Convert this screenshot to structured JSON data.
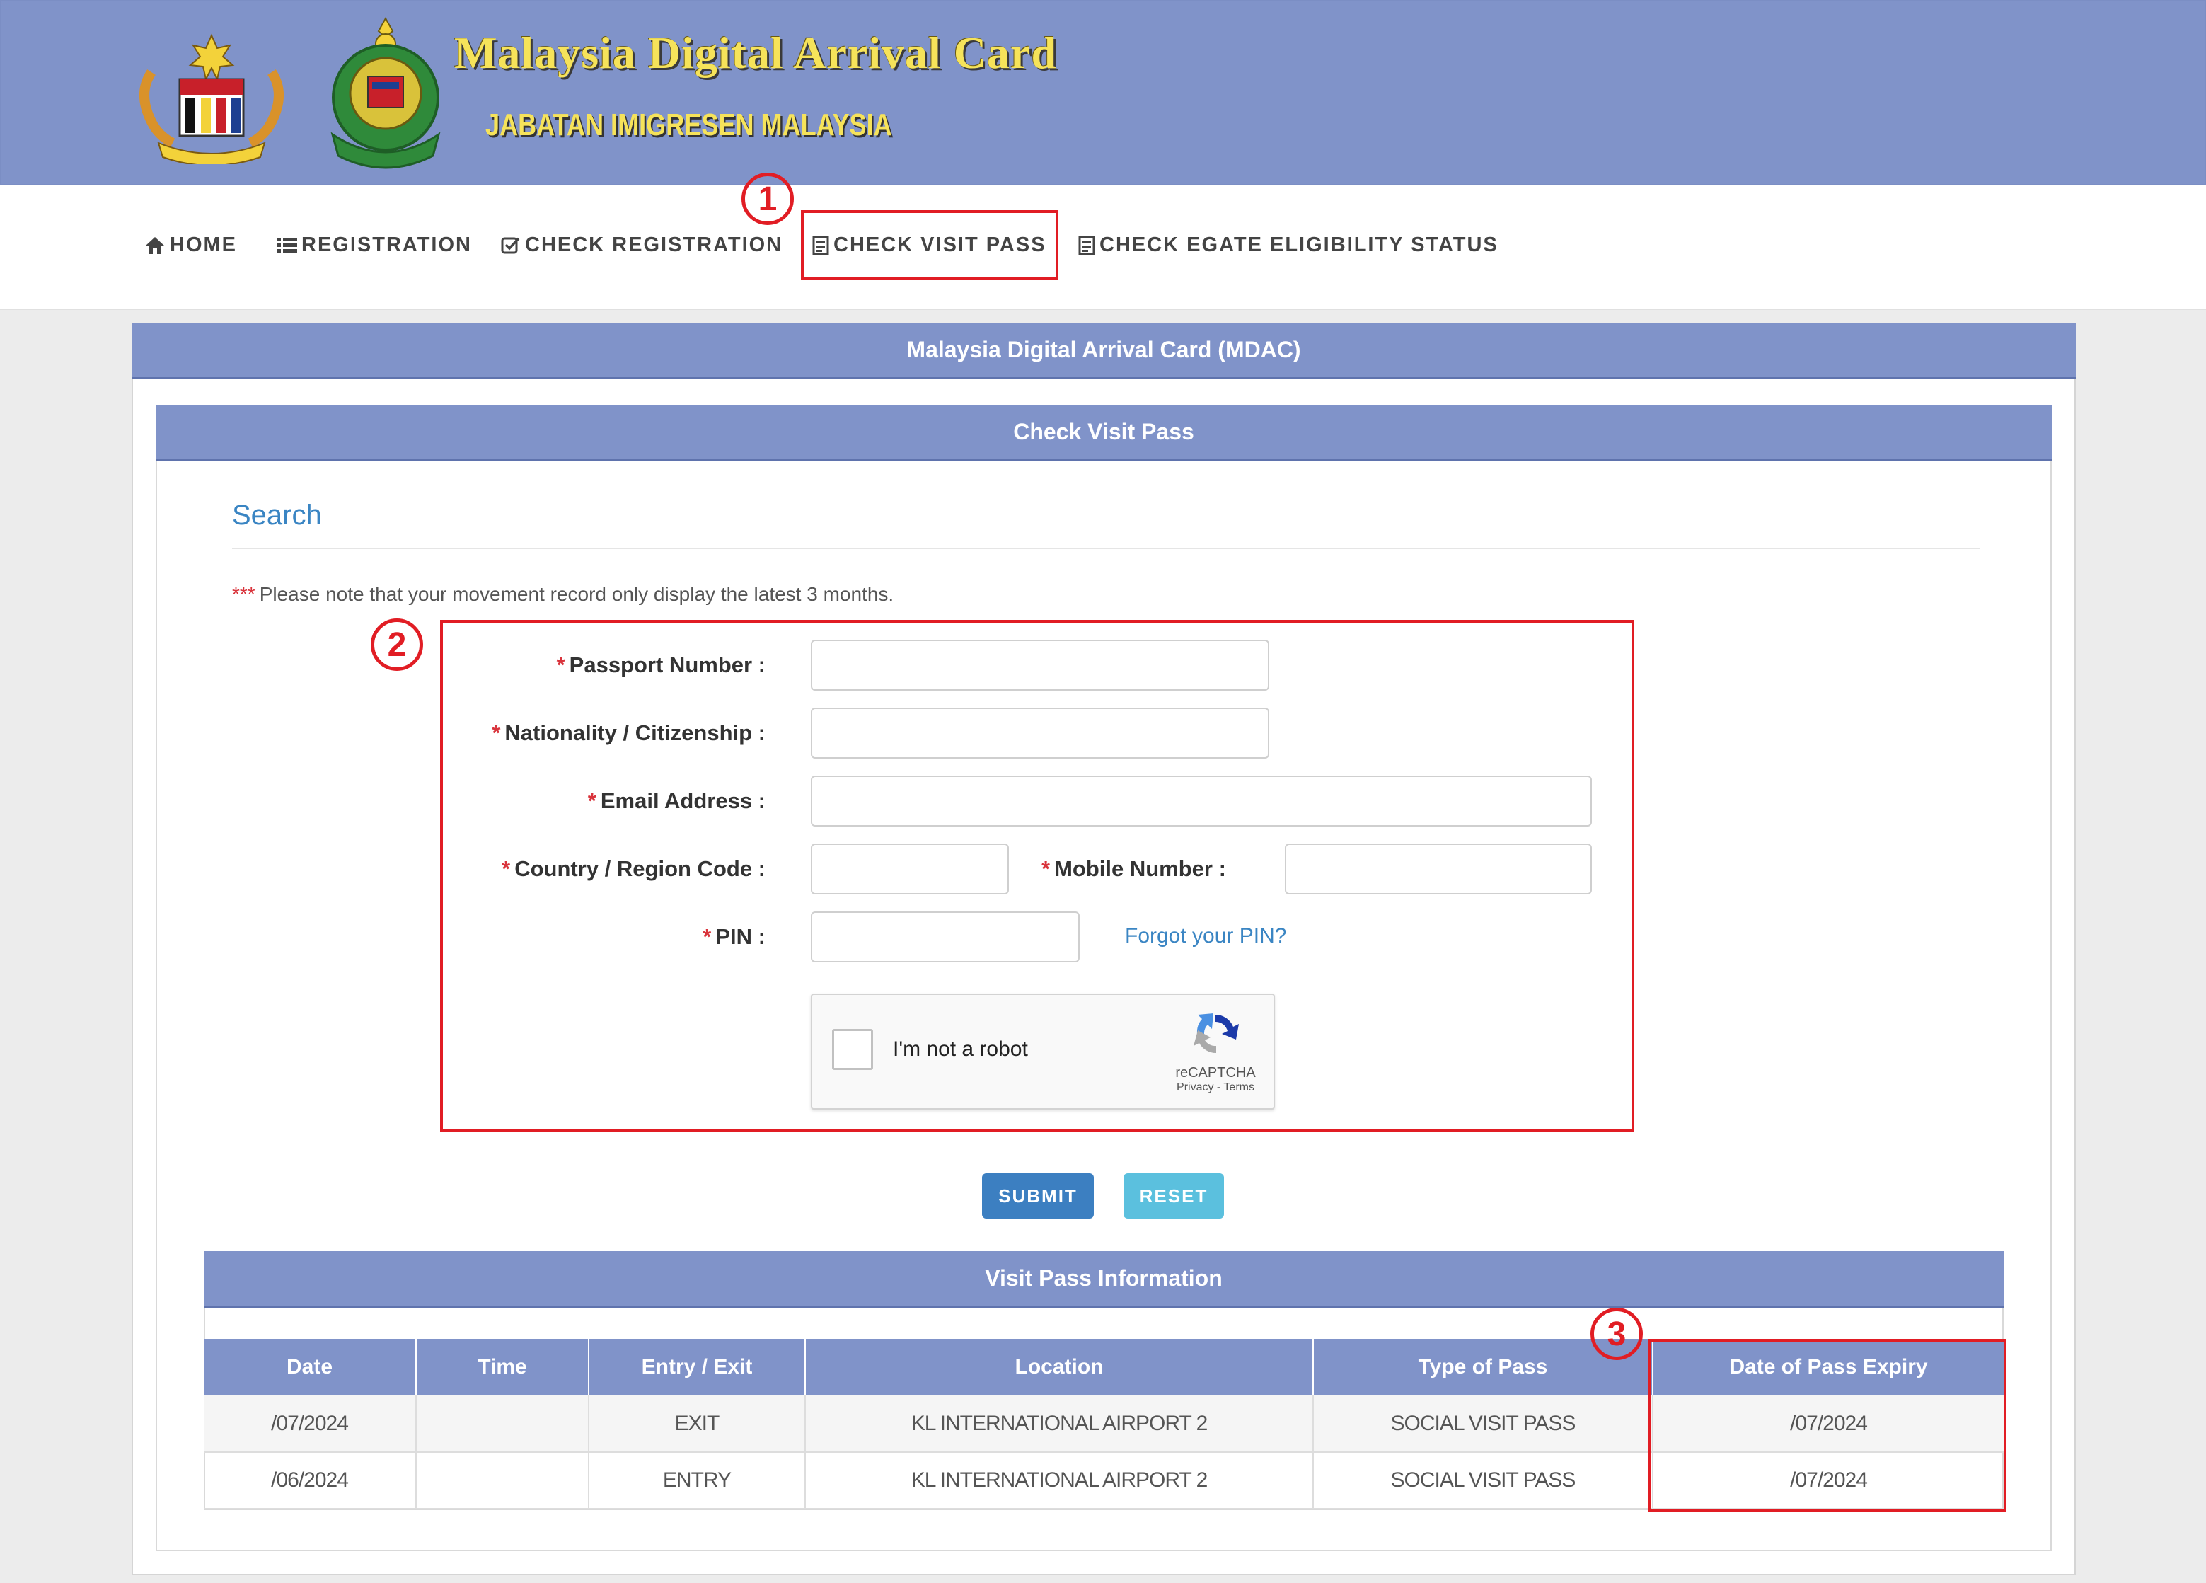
{
  "header": {
    "title": "Malaysia Digital Arrival Card",
    "subtitle": "JABATAN IMIGRESEN MALAYSIA"
  },
  "nav": {
    "items": [
      {
        "label": "HOME",
        "icon": "home-icon"
      },
      {
        "label": "REGISTRATION",
        "icon": "list-icon"
      },
      {
        "label": "CHECK REGISTRATION",
        "icon": "check-icon"
      },
      {
        "label": "CHECK VISIT PASS",
        "icon": "document-icon"
      },
      {
        "label": "CHECK EGATE ELIGIBILITY STATUS",
        "icon": "document-icon"
      }
    ]
  },
  "annotations": {
    "m1": "1",
    "m2": "2",
    "m3": "3"
  },
  "panel": {
    "title": "Malaysia Digital Arrival Card (MDAC)",
    "subtitle": "Check Visit Pass"
  },
  "search": {
    "title": "Search",
    "note_stars": "***",
    "note": "Please note that your movement record only display the latest 3 months."
  },
  "form": {
    "required_mark": "*",
    "passport_label": "Passport Number :",
    "nationality_label": "Nationality / Citizenship :",
    "email_label": "Email Address :",
    "country_label": "Country / Region Code :",
    "mobile_label": "Mobile Number :",
    "pin_label": "PIN :",
    "passport_value": "",
    "nationality_value": "",
    "email_value": "",
    "country_value": "",
    "mobile_value": "",
    "pin_value": "",
    "forgot_pin": "Forgot your PIN?"
  },
  "captcha": {
    "label": "I'm not a robot",
    "brand": "reCAPTCHA",
    "links": "Privacy - Terms"
  },
  "buttons": {
    "submit": "SUBMIT",
    "reset": "RESET"
  },
  "visit_pass": {
    "title": "Visit Pass Information",
    "columns": [
      "Date",
      "Time",
      "Entry / Exit",
      "Location",
      "Type of Pass",
      "Date of Pass Expiry"
    ],
    "rows": [
      {
        "date": "/07/2024",
        "time": "",
        "entry_exit": "EXIT",
        "location": "KL INTERNATIONAL AIRPORT 2",
        "pass_type": "SOCIAL VISIT PASS",
        "expiry": "/07/2024"
      },
      {
        "date": "/06/2024",
        "time": "",
        "entry_exit": "ENTRY",
        "location": "KL INTERNATIONAL AIRPORT 2",
        "pass_type": "SOCIAL VISIT PASS",
        "expiry": "/07/2024"
      }
    ]
  },
  "colors": {
    "header_bg": "#8093c9",
    "highlight_red": "#e11d24",
    "link_blue": "#3a85c3",
    "submit_blue": "#3c7fc1",
    "reset_cyan": "#5bc0de",
    "title_yellow": "#f6e35a"
  }
}
